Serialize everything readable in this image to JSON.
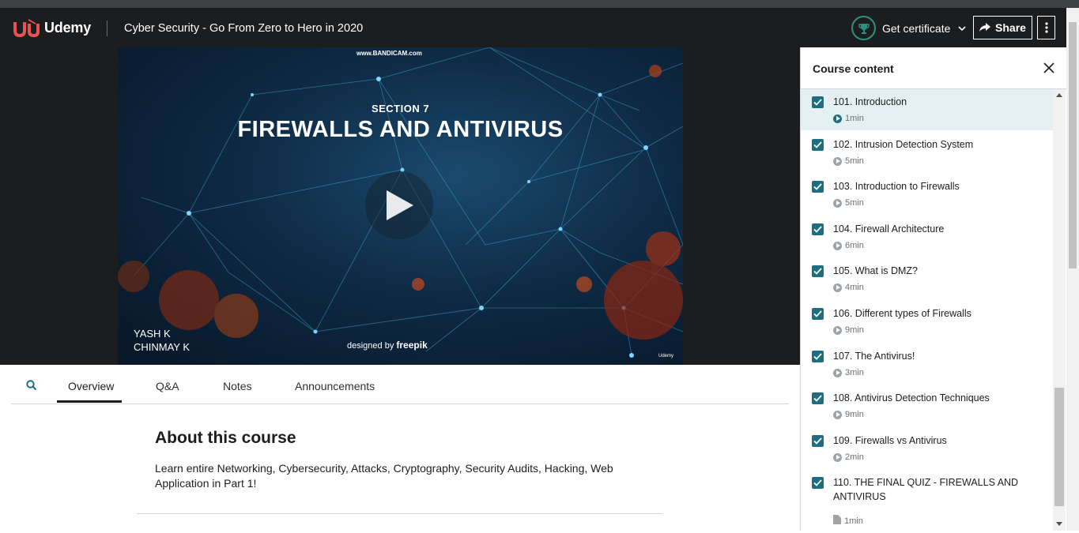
{
  "header": {
    "logo_text": "Udemy",
    "course_title": "Cyber Security - Go From Zero to Hero in 2020",
    "certificate_label": "Get certificate",
    "share_label": "Share"
  },
  "video": {
    "watermark": "www.BANDICAM.com",
    "section_label": "SECTION 7",
    "title": "FIREWALLS AND ANTIVIRUS",
    "author_1": "YASH K",
    "author_2": "CHINMAY K",
    "designed_by": "designed by",
    "designer": "freepik",
    "brand_mini": "Udemy"
  },
  "tabs": [
    {
      "label": "Overview"
    },
    {
      "label": "Q&A"
    },
    {
      "label": "Notes"
    },
    {
      "label": "Announcements"
    }
  ],
  "about": {
    "heading": "About this course",
    "description": "Learn entire Networking, Cybersecurity, Attacks, Cryptography, Security Audits, Hacking, Web Application in Part 1!"
  },
  "sidebar": {
    "title": "Course content",
    "items": [
      {
        "title": "101. Introduction",
        "duration": "1min",
        "type": "video",
        "completed": true,
        "active": true
      },
      {
        "title": "102. Intrusion Detection System",
        "duration": "5min",
        "type": "video",
        "completed": true
      },
      {
        "title": "103. Introduction to Firewalls",
        "duration": "5min",
        "type": "video",
        "completed": true
      },
      {
        "title": "104. Firewall Architecture",
        "duration": "6min",
        "type": "video",
        "completed": true
      },
      {
        "title": "105. What is DMZ?",
        "duration": "4min",
        "type": "video",
        "completed": true
      },
      {
        "title": "106. Different types of Firewalls",
        "duration": "9min",
        "type": "video",
        "completed": true
      },
      {
        "title": "107. The Antivirus!",
        "duration": "3min",
        "type": "video",
        "completed": true
      },
      {
        "title": "108. Antivirus Detection Techniques",
        "duration": "9min",
        "type": "video",
        "completed": true
      },
      {
        "title": "109. Firewalls vs Antivirus",
        "duration": "2min",
        "type": "video",
        "completed": true
      },
      {
        "title": "110. THE FINAL QUIZ - FIREWALLS AND ANTIVIRUS",
        "duration": "1min",
        "type": "quiz",
        "completed": true
      }
    ]
  },
  "colors": {
    "header_bg": "#1c1d1f",
    "accent_teal": "#1c6f81",
    "active_row": "#e4f0f2",
    "cert_ring": "#2d907f",
    "logo_red": "#ea5252"
  }
}
